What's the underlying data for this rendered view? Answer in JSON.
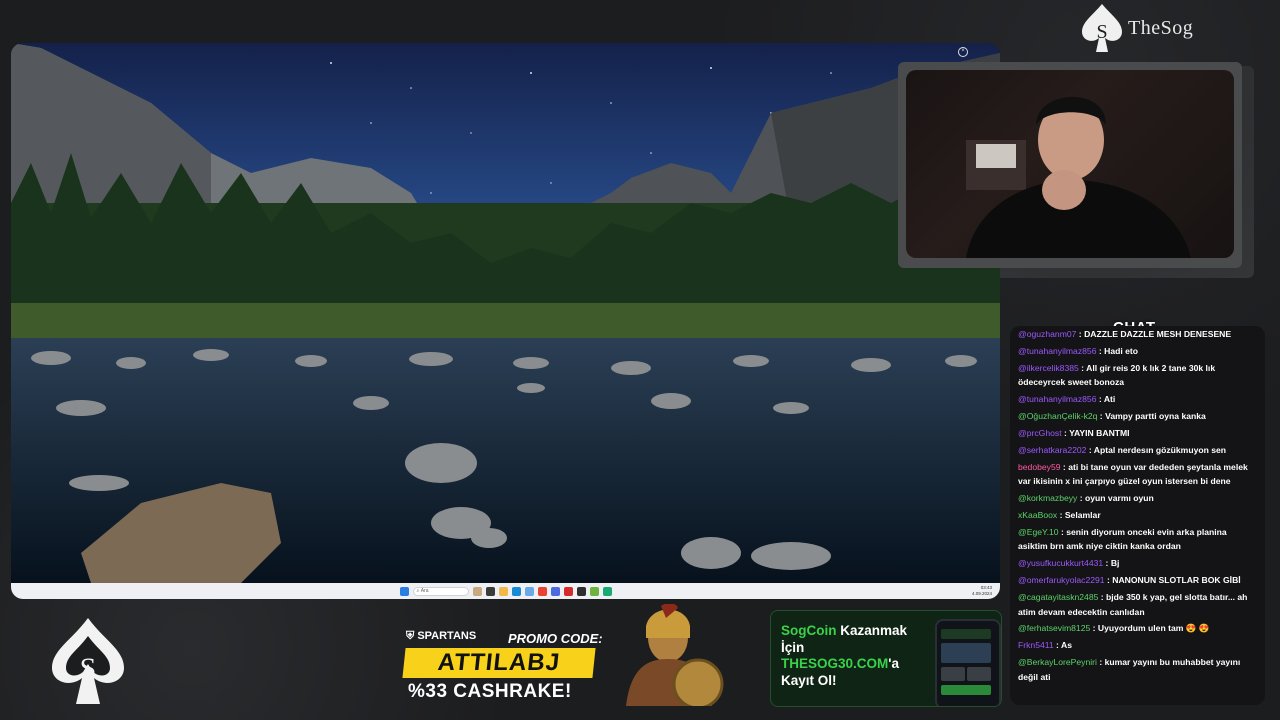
{
  "brand": {
    "name": "TheSog"
  },
  "desktop": {
    "taskbar": {
      "search_placeholder": "Ara",
      "time": "03:43",
      "date": "4.09.2024"
    }
  },
  "chat": {
    "title": "CHAT",
    "messages": [
      {
        "user": "@oguzhanm07",
        "text": "DAZZLE DAZZLE MESH DENESENE",
        "color": "#9b59ff"
      },
      {
        "user": "@tunahanyilmaz856",
        "text": "Hadi eto",
        "color": "#9b59ff"
      },
      {
        "user": "@ilkercelik8385",
        "text": "All gir reis 20 k lık 2 tane 30k lık ödeceyrcek sweet bonoza",
        "color": "#9b59ff"
      },
      {
        "user": "@tunahanyilmaz856",
        "text": "Ati",
        "color": "#9b59ff"
      },
      {
        "user": "@OğuzhanÇelik-k2q",
        "text": "Vampy partti oyna kanka",
        "color": "#5bd36a"
      },
      {
        "user": "@prcGhost",
        "text": "YAYIN BANTMI",
        "color": "#9b59ff"
      },
      {
        "user": "@serhatkara2202",
        "text": "Aptal nerdesın gözükmuyon sen",
        "color": "#9b59ff"
      },
      {
        "user": "bedobey59",
        "text": "ati bi tane oyun var dededen şeytanla melek var ikisinin x ini çarpıyo güzel oyun istersen bi dene",
        "color": "#ff5aa5"
      },
      {
        "user": "@korkmazbeyy",
        "text": "oyun varmı oyun",
        "color": "#5bd36a"
      },
      {
        "user": "xKaaBoox",
        "text": "Selamlar",
        "color": "#5bd36a"
      },
      {
        "user": "@EgeY.10",
        "text": "senin diyorum onceki evin arka planina asiktim brn amk niye ciktin kanka ordan",
        "color": "#5bd36a"
      },
      {
        "user": "@yusufkucukkurt4431",
        "text": "Bj",
        "color": "#9b59ff"
      },
      {
        "user": "@omerfarukyolac2291",
        "text": "NANONUN SLOTLAR BOK GİBİ",
        "color": "#9b59ff"
      },
      {
        "user": "@cagatayitaskn2485",
        "text": "bjde 350 k yap, gel slotta batır... ah atim devam edecektin canlıdan",
        "color": "#5bd36a"
      },
      {
        "user": "@ferhatsevim8125",
        "text": "Uyuyordum ulen tam 😍 😍",
        "color": "#5bd36a"
      },
      {
        "user": "Frkn5411",
        "text": "As",
        "color": "#9b59ff"
      },
      {
        "user": "@BerkayLorePeyniri",
        "text": "kumar yayını bu muhabbet yayını değil ati",
        "color": "#5bd36a"
      }
    ]
  },
  "promo": {
    "brand": "SPARTANS",
    "code_label": "PROMO CODE:",
    "code": "ATTILABJ",
    "cashback": "%33 CASHRAKE!"
  },
  "sogcoin": {
    "line1_green": "SogCoin",
    "line1_white": " Kazanmak",
    "line2": "İçin",
    "line3_green": "THESOG30.COM",
    "line3_white": "'a",
    "line4": "Kayıt Ol!"
  }
}
